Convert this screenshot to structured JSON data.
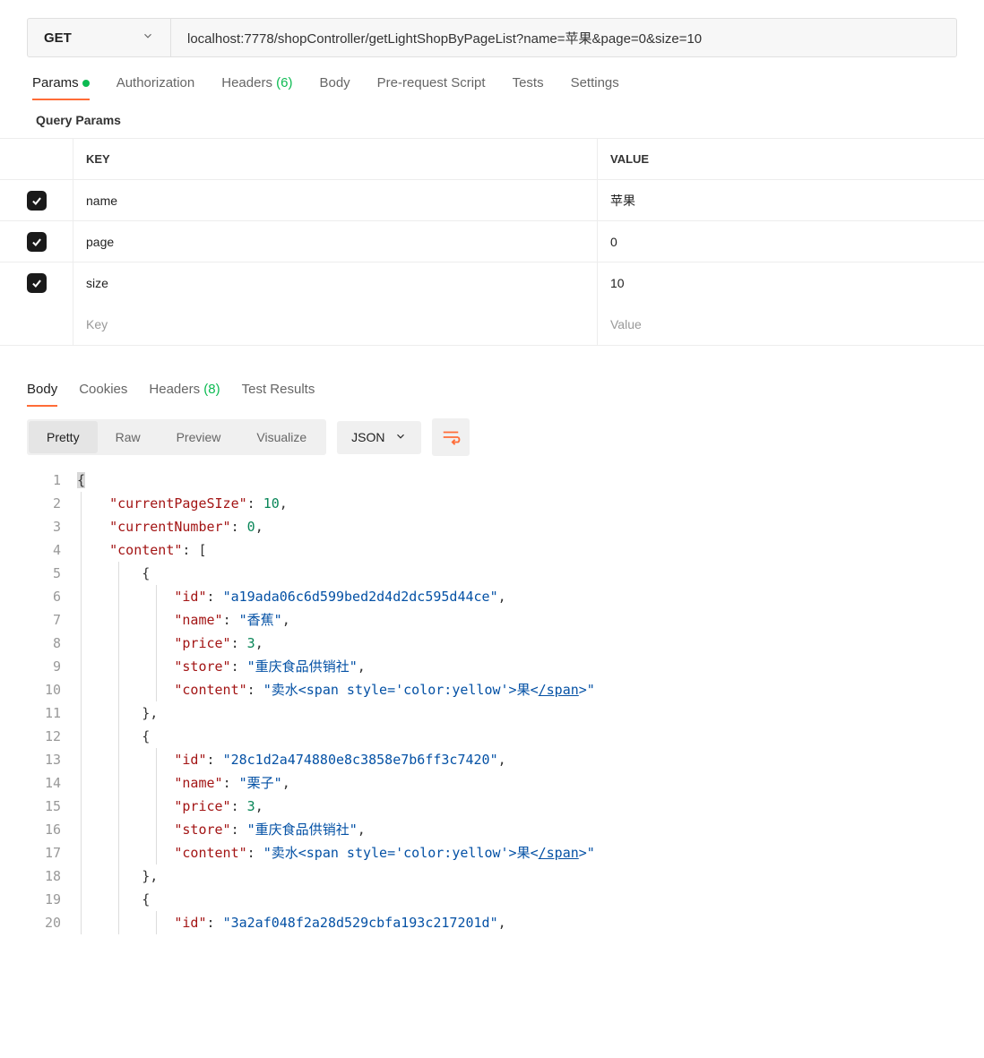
{
  "request": {
    "method": "GET",
    "url": "localhost:7778/shopController/getLightShopByPageList?name=苹果&page=0&size=10"
  },
  "tabs": {
    "params": "Params",
    "authorization": "Authorization",
    "headers": "Headers",
    "headers_count": "(6)",
    "body": "Body",
    "prerequest": "Pre-request Script",
    "tests": "Tests",
    "settings": "Settings"
  },
  "section": {
    "query_params": "Query Params",
    "key_header": "KEY",
    "value_header": "VALUE",
    "key_placeholder": "Key",
    "value_placeholder": "Value"
  },
  "params": [
    {
      "key": "name",
      "value": "苹果",
      "checked": true
    },
    {
      "key": "page",
      "value": "0",
      "checked": true
    },
    {
      "key": "size",
      "value": "10",
      "checked": true
    }
  ],
  "response_tabs": {
    "body": "Body",
    "cookies": "Cookies",
    "headers": "Headers",
    "headers_count": "(8)",
    "test_results": "Test Results"
  },
  "view": {
    "pretty": "Pretty",
    "raw": "Raw",
    "preview": "Preview",
    "visualize": "Visualize",
    "format": "JSON"
  },
  "json_lines": [
    {
      "n": 1,
      "indent": 0,
      "tokens": [
        {
          "t": "brace",
          "v": "{",
          "hl": true
        }
      ]
    },
    {
      "n": 2,
      "indent": 1,
      "tokens": [
        {
          "t": "key",
          "v": "\"currentPageSIze\""
        },
        {
          "t": "punct",
          "v": ": "
        },
        {
          "t": "num",
          "v": "10"
        },
        {
          "t": "punct",
          "v": ","
        }
      ]
    },
    {
      "n": 3,
      "indent": 1,
      "tokens": [
        {
          "t": "key",
          "v": "\"currentNumber\""
        },
        {
          "t": "punct",
          "v": ": "
        },
        {
          "t": "num",
          "v": "0"
        },
        {
          "t": "punct",
          "v": ","
        }
      ]
    },
    {
      "n": 4,
      "indent": 1,
      "tokens": [
        {
          "t": "key",
          "v": "\"content\""
        },
        {
          "t": "punct",
          "v": ": "
        },
        {
          "t": "brace",
          "v": "["
        }
      ]
    },
    {
      "n": 5,
      "indent": 2,
      "tokens": [
        {
          "t": "brace",
          "v": "{"
        }
      ]
    },
    {
      "n": 6,
      "indent": 3,
      "tokens": [
        {
          "t": "key",
          "v": "\"id\""
        },
        {
          "t": "punct",
          "v": ": "
        },
        {
          "t": "str",
          "v": "\"a19ada06c6d599bed2d4d2dc595d44ce\""
        },
        {
          "t": "punct",
          "v": ","
        }
      ]
    },
    {
      "n": 7,
      "indent": 3,
      "tokens": [
        {
          "t": "key",
          "v": "\"name\""
        },
        {
          "t": "punct",
          "v": ": "
        },
        {
          "t": "str",
          "v": "\"香蕉\""
        },
        {
          "t": "punct",
          "v": ","
        }
      ]
    },
    {
      "n": 8,
      "indent": 3,
      "tokens": [
        {
          "t": "key",
          "v": "\"price\""
        },
        {
          "t": "punct",
          "v": ": "
        },
        {
          "t": "num",
          "v": "3"
        },
        {
          "t": "punct",
          "v": ","
        }
      ]
    },
    {
      "n": 9,
      "indent": 3,
      "tokens": [
        {
          "t": "key",
          "v": "\"store\""
        },
        {
          "t": "punct",
          "v": ": "
        },
        {
          "t": "str",
          "v": "\"重庆食品供销社\""
        },
        {
          "t": "punct",
          "v": ","
        }
      ]
    },
    {
      "n": 10,
      "indent": 3,
      "tokens": [
        {
          "t": "key",
          "v": "\"content\""
        },
        {
          "t": "punct",
          "v": ": "
        },
        {
          "t": "str",
          "v": "\"卖水<span style='color:yellow'>果<"
        },
        {
          "t": "str",
          "v": "/span",
          "link": true
        },
        {
          "t": "str",
          "v": ">\""
        }
      ]
    },
    {
      "n": 11,
      "indent": 2,
      "tokens": [
        {
          "t": "brace",
          "v": "}"
        },
        {
          "t": "punct",
          "v": ","
        }
      ]
    },
    {
      "n": 12,
      "indent": 2,
      "tokens": [
        {
          "t": "brace",
          "v": "{"
        }
      ]
    },
    {
      "n": 13,
      "indent": 3,
      "tokens": [
        {
          "t": "key",
          "v": "\"id\""
        },
        {
          "t": "punct",
          "v": ": "
        },
        {
          "t": "str",
          "v": "\"28c1d2a474880e8c3858e7b6ff3c7420\""
        },
        {
          "t": "punct",
          "v": ","
        }
      ]
    },
    {
      "n": 14,
      "indent": 3,
      "tokens": [
        {
          "t": "key",
          "v": "\"name\""
        },
        {
          "t": "punct",
          "v": ": "
        },
        {
          "t": "str",
          "v": "\"栗子\""
        },
        {
          "t": "punct",
          "v": ","
        }
      ]
    },
    {
      "n": 15,
      "indent": 3,
      "tokens": [
        {
          "t": "key",
          "v": "\"price\""
        },
        {
          "t": "punct",
          "v": ": "
        },
        {
          "t": "num",
          "v": "3"
        },
        {
          "t": "punct",
          "v": ","
        }
      ]
    },
    {
      "n": 16,
      "indent": 3,
      "tokens": [
        {
          "t": "key",
          "v": "\"store\""
        },
        {
          "t": "punct",
          "v": ": "
        },
        {
          "t": "str",
          "v": "\"重庆食品供销社\""
        },
        {
          "t": "punct",
          "v": ","
        }
      ]
    },
    {
      "n": 17,
      "indent": 3,
      "tokens": [
        {
          "t": "key",
          "v": "\"content\""
        },
        {
          "t": "punct",
          "v": ": "
        },
        {
          "t": "str",
          "v": "\"卖水<span style='color:yellow'>果<"
        },
        {
          "t": "str",
          "v": "/span",
          "link": true
        },
        {
          "t": "str",
          "v": ">\""
        }
      ]
    },
    {
      "n": 18,
      "indent": 2,
      "tokens": [
        {
          "t": "brace",
          "v": "}"
        },
        {
          "t": "punct",
          "v": ","
        }
      ]
    },
    {
      "n": 19,
      "indent": 2,
      "tokens": [
        {
          "t": "brace",
          "v": "{"
        }
      ]
    },
    {
      "n": 20,
      "indent": 3,
      "tokens": [
        {
          "t": "key",
          "v": "\"id\""
        },
        {
          "t": "punct",
          "v": ": "
        },
        {
          "t": "str",
          "v": "\"3a2af048f2a28d529cbfa193c217201d\""
        },
        {
          "t": "punct",
          "v": ","
        }
      ]
    }
  ]
}
